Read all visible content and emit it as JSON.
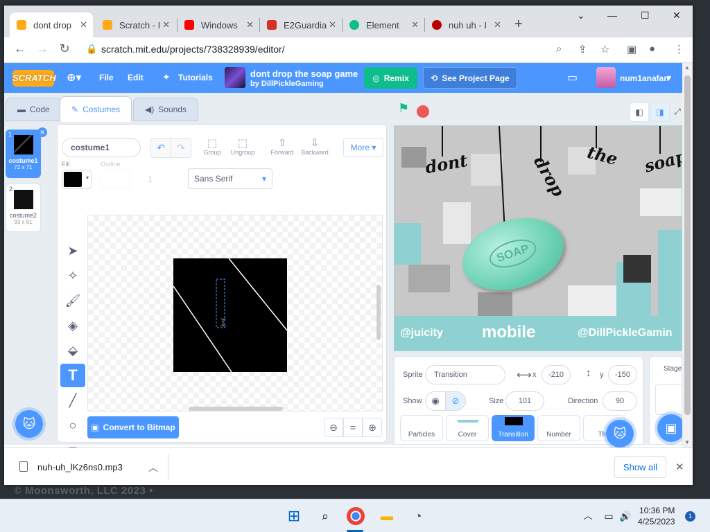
{
  "browser": {
    "tabs": [
      {
        "title": "dont drop",
        "icon": "scratch-favicon",
        "active": true
      },
      {
        "title": "Scratch - I",
        "icon": "scratch-favicon"
      },
      {
        "title": "Windows",
        "icon": "youtube-favicon"
      },
      {
        "title": "E2Guardia",
        "icon": "gmail-favicon"
      },
      {
        "title": "Element",
        "icon": "element-favicon"
      },
      {
        "title": "nuh uh - I",
        "icon": "record-favicon"
      }
    ],
    "url": "scratch.mit.edu/projects/738328939/editor/"
  },
  "menubar": {
    "logo": "SCRATCH",
    "file": "File",
    "edit": "Edit",
    "tutorials": "Tutorials",
    "project_title": "dont drop the soap game",
    "project_author": "by DillPickleGaming",
    "remix": "Remix",
    "see_project": "See Project Page",
    "username": "num1anafan"
  },
  "editor": {
    "tabs": {
      "code": "Code",
      "costumes": "Costumes",
      "sounds": "Sounds"
    },
    "costumes": [
      {
        "index": "1",
        "name": "costume1",
        "size": "72 x 71"
      },
      {
        "index": "2",
        "name": "costume2",
        "size": "93 x 61"
      }
    ],
    "costume_name": "costume1",
    "group": "Group",
    "ungroup": "Ungroup",
    "forward": "Forward",
    "backward": "Backward",
    "more": "More",
    "fill_label": "Fill",
    "outline_label": "Outline",
    "outline_value": "1",
    "font": "Sans Serif",
    "convert": "Convert to Bitmap",
    "zoom_reset": "="
  },
  "stage": {
    "words": [
      "dont",
      "drop",
      "the",
      "soap"
    ],
    "soap_text": "SOAP",
    "footer_left": "@juicity",
    "footer_mid": "mobile",
    "footer_right": "@DillPickleGamin"
  },
  "sprite": {
    "label": "Sprite",
    "name": "Transition",
    "x_label": "x",
    "x": "-210",
    "y_label": "y",
    "y": "-150",
    "show_label": "Show",
    "size_label": "Size",
    "size": "101",
    "direction_label": "Direction",
    "direction": "90",
    "sprites": [
      "Particles",
      "Cover",
      "Transition",
      "Number",
      "Thu"
    ],
    "stage_label": "Stage",
    "backdrops_label": "B"
  },
  "download": {
    "file": "nuh-uh_lKz6ns0.mp3",
    "show_all": "Show all"
  },
  "background": {
    "copyright": "© Moonsworth, LLC 2023 •"
  },
  "taskbar": {
    "time": "10:36 PM",
    "date": "4/25/2023",
    "notifications": "1"
  }
}
